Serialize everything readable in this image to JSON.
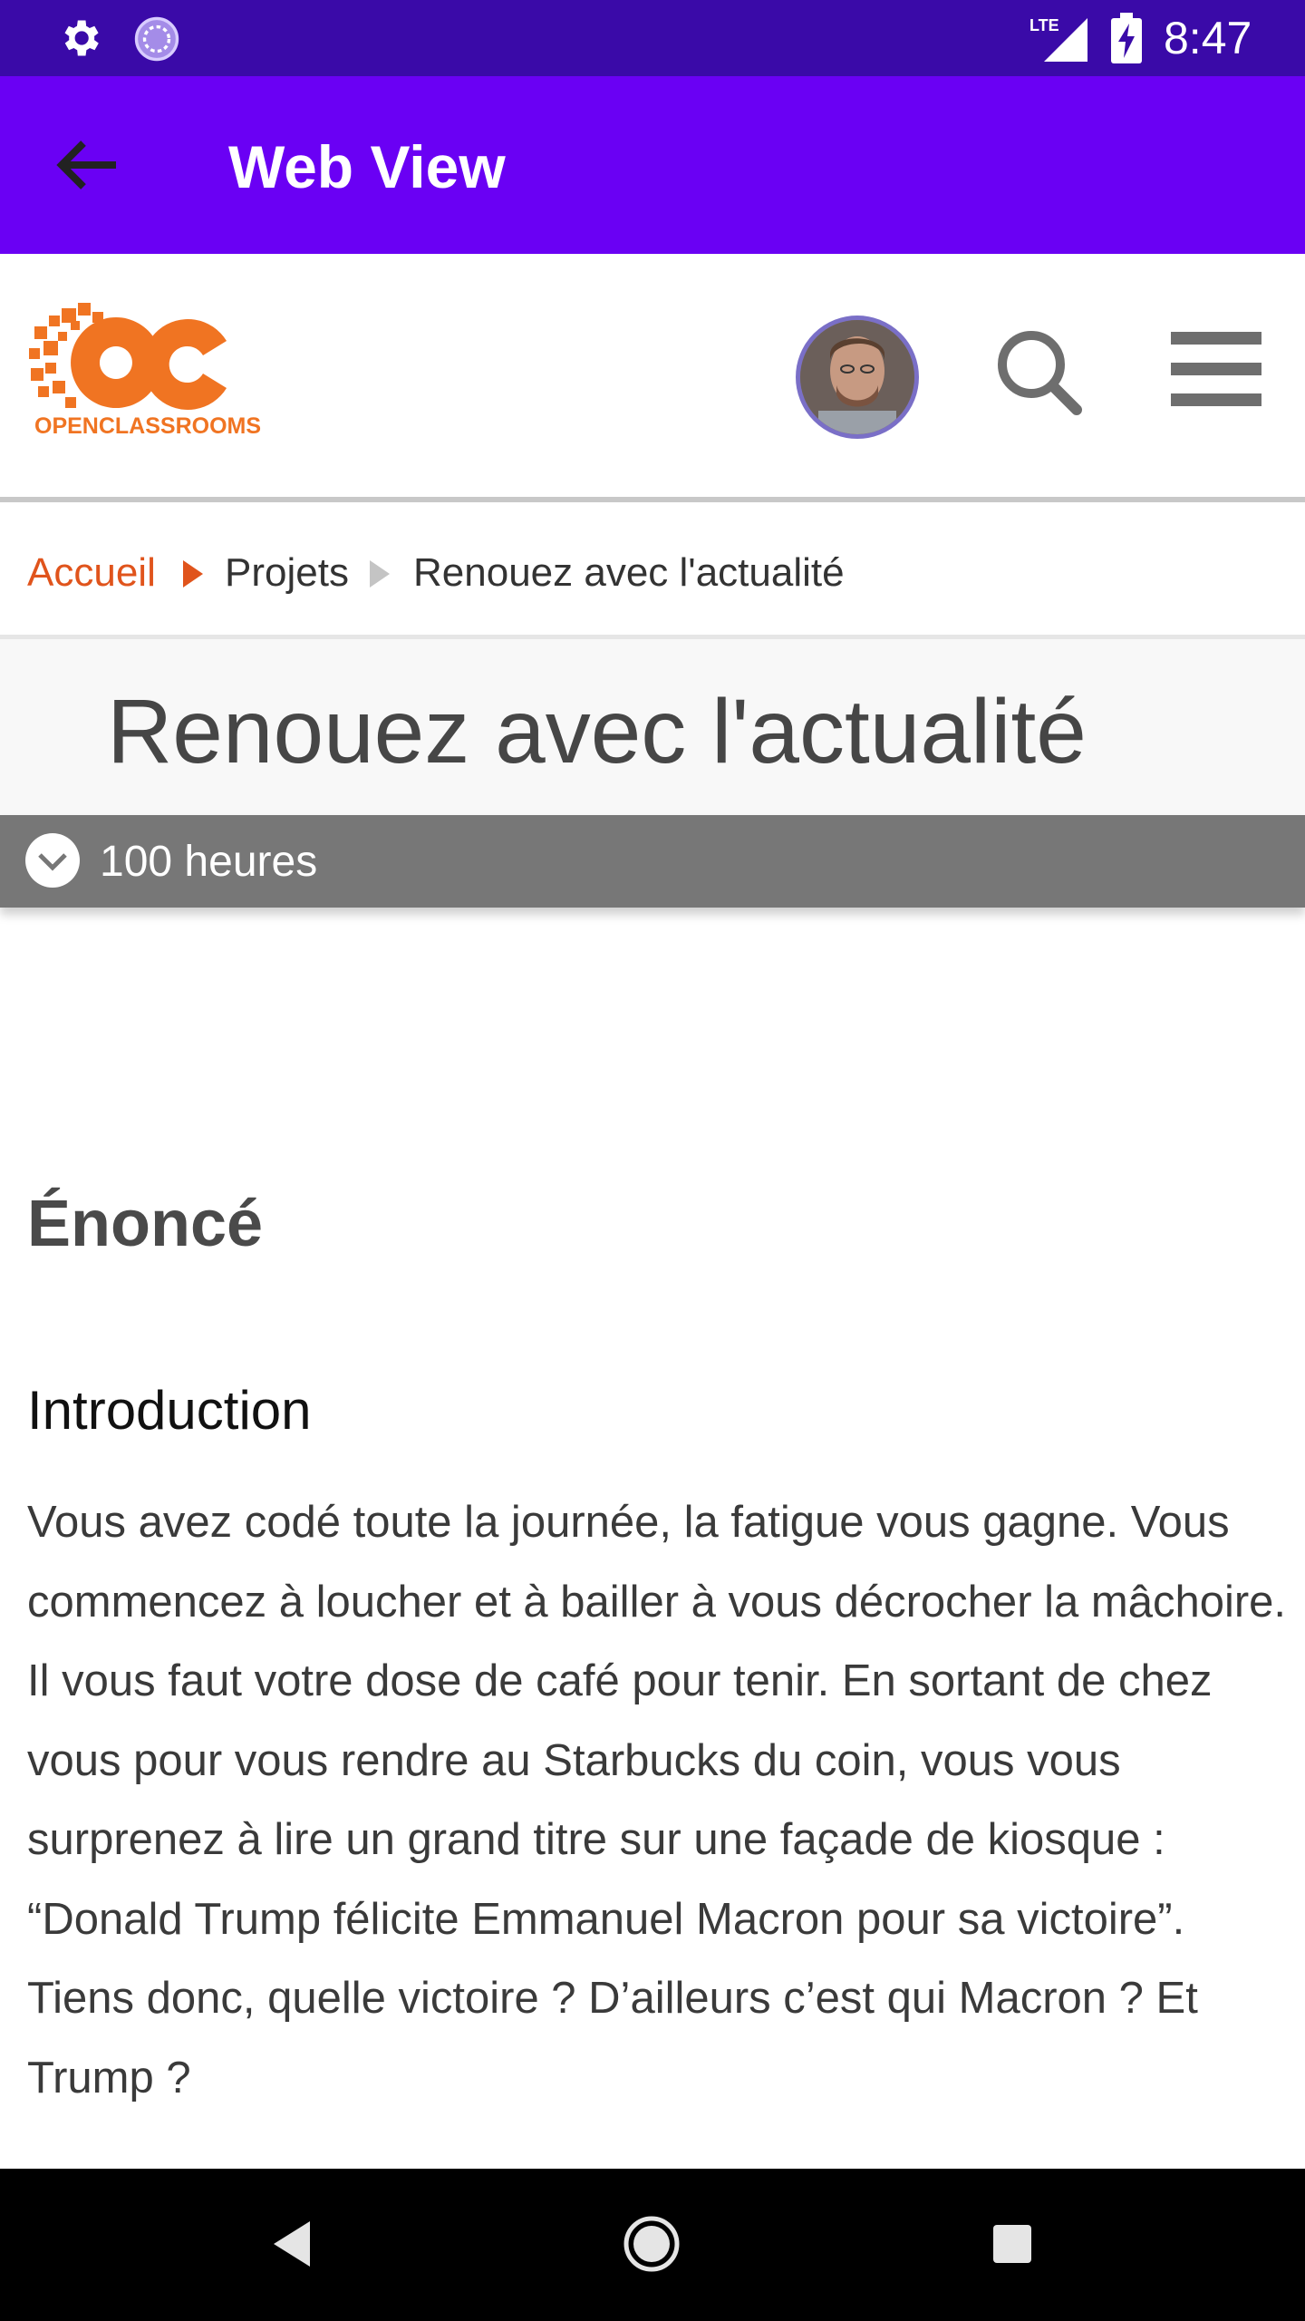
{
  "status_bar": {
    "time": "8:47",
    "network": "LTE"
  },
  "app_bar": {
    "title": "Web View"
  },
  "site_header": {
    "logo_text": "OPENCLASSROOMS"
  },
  "breadcrumb": {
    "home": "Accueil",
    "projects": "Projets",
    "current": "Renouez avec l'actualité"
  },
  "page": {
    "title": "Renouez avec l'actualité",
    "duration": "100 heures"
  },
  "content": {
    "heading": "Énoncé",
    "subheading": "Introduction",
    "paragraph": "Vous avez codé toute la journée, la fatigue vous gagne. Vous commencez à loucher et à bailler à vous décrocher la mâchoire. Il vous faut votre dose de café pour tenir. En sortant de chez vous pour vous rendre au Starbucks du coin, vous vous surprenez à lire un grand titre sur une façade de kiosque : “Donald Trump félicite Emmanuel Macron pour sa victoire”. Tiens donc, quelle victoire ? D’ailleurs c’est qui Macron ? Et Trump ?"
  },
  "colors": {
    "status_bar": "#3a0aa8",
    "app_bar": "#6a00f4",
    "brand_orange": "#f07422",
    "breadcrumb_link": "#e0541c",
    "duration_bar": "#777777"
  },
  "icons": {
    "status": [
      "gear-icon",
      "sync-icon",
      "lte-signal-icon",
      "battery-charging-icon"
    ],
    "app_bar": "back-arrow-icon",
    "header": [
      "avatar",
      "search-icon",
      "hamburger-menu-icon"
    ],
    "duration": "chevron-down-circle-icon",
    "nav": [
      "nav-back-icon",
      "nav-home-icon",
      "nav-recents-icon"
    ]
  }
}
